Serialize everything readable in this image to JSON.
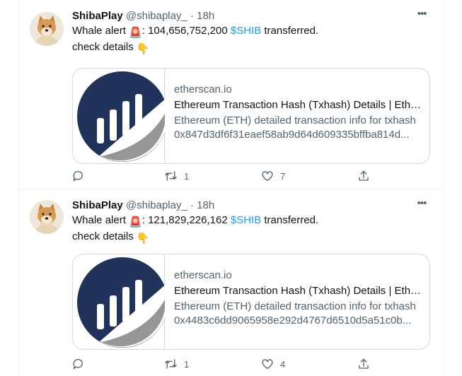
{
  "tweets": [
    {
      "author_name": "ShibaPlay",
      "handle": "@shibaplay_",
      "separator": "·",
      "time": "18h",
      "more_label": "•••",
      "text_prefix": "Whale alert ",
      "alert_emoji": "🚨",
      "amount": ": 104,656,752,200 ",
      "cashtag": "$SHIB",
      "text_suffix": " transferred.",
      "line2": "check details ",
      "point_emoji": "👇",
      "card": {
        "domain": "etherscan.io",
        "title": "Ethereum Transaction Hash (Txhash) Details | Ethe...",
        "description_line1": "Ethereum (ETH) detailed transaction info for txhash",
        "description_line2": "0x847d3df6f31eaef58ab9d64d609335bffba814d..."
      },
      "retweets": "1",
      "likes": "7"
    },
    {
      "author_name": "ShibaPlay",
      "handle": "@shibaplay_",
      "separator": "·",
      "time": "18h",
      "more_label": "•••",
      "text_prefix": "Whale alert ",
      "alert_emoji": "🚨",
      "amount": ": 121,829,226,162 ",
      "cashtag": "$SHIB",
      "text_suffix": " transferred.",
      "line2": "check details ",
      "point_emoji": "👇",
      "card": {
        "domain": "etherscan.io",
        "title": "Ethereum Transaction Hash (Txhash) Details | Ethe...",
        "description_line1": "Ethereum (ETH) detailed transaction info for txhash",
        "description_line2": "0x4483c6dd9065958e292d4767d6510d5a51c0b..."
      },
      "retweets": "1",
      "likes": "4"
    }
  ],
  "colors": {
    "link_blue": "#1d9bf0",
    "secondary_text": "#536471",
    "border": "#cfd9de",
    "etherscan_navy": "#21325b",
    "etherscan_gray": "#979695"
  },
  "icons": [
    "reply-icon",
    "retweet-icon",
    "like-icon",
    "share-icon",
    "more-icon",
    "etherscan-logo-icon"
  ]
}
